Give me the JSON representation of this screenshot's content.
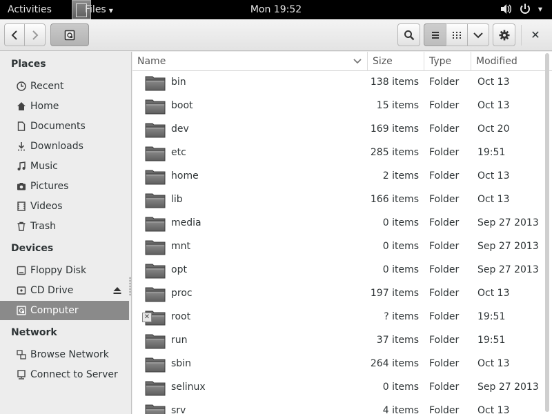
{
  "topbar": {
    "activities": "Activities",
    "app_name": "Files",
    "clock": "Mon 19:52"
  },
  "sidebar": {
    "headings": {
      "places": "Places",
      "devices": "Devices",
      "network": "Network"
    },
    "places": [
      {
        "label": "Recent",
        "icon": "clock-icon"
      },
      {
        "label": "Home",
        "icon": "home-icon"
      },
      {
        "label": "Documents",
        "icon": "document-icon"
      },
      {
        "label": "Downloads",
        "icon": "download-icon"
      },
      {
        "label": "Music",
        "icon": "music-icon"
      },
      {
        "label": "Pictures",
        "icon": "camera-icon"
      },
      {
        "label": "Videos",
        "icon": "film-icon"
      },
      {
        "label": "Trash",
        "icon": "trash-icon"
      }
    ],
    "devices": [
      {
        "label": "Floppy Disk",
        "icon": "floppy-icon"
      },
      {
        "label": "CD Drive",
        "icon": "cd-icon"
      },
      {
        "label": "Computer",
        "icon": "computer-icon",
        "selected": true
      }
    ],
    "network": [
      {
        "label": "Browse Network",
        "icon": "network-icon"
      },
      {
        "label": "Connect to Server",
        "icon": "server-icon"
      }
    ]
  },
  "columns": {
    "name": "Name",
    "size": "Size",
    "type": "Type",
    "modified": "Modified"
  },
  "files": [
    {
      "name": "bin",
      "size": "138 items",
      "type": "Folder",
      "modified": "Oct 13"
    },
    {
      "name": "boot",
      "size": "15 items",
      "type": "Folder",
      "modified": "Oct 13"
    },
    {
      "name": "dev",
      "size": "169 items",
      "type": "Folder",
      "modified": "Oct 20"
    },
    {
      "name": "etc",
      "size": "285 items",
      "type": "Folder",
      "modified": "19:51"
    },
    {
      "name": "home",
      "size": "2 items",
      "type": "Folder",
      "modified": "Oct 13"
    },
    {
      "name": "lib",
      "size": "166 items",
      "type": "Folder",
      "modified": "Oct 13"
    },
    {
      "name": "media",
      "size": "0 items",
      "type": "Folder",
      "modified": "Sep 27 2013"
    },
    {
      "name": "mnt",
      "size": "0 items",
      "type": "Folder",
      "modified": "Sep 27 2013"
    },
    {
      "name": "opt",
      "size": "0 items",
      "type": "Folder",
      "modified": "Sep 27 2013"
    },
    {
      "name": "proc",
      "size": "197 items",
      "type": "Folder",
      "modified": "Oct 13"
    },
    {
      "name": "root",
      "size": "? items",
      "type": "Folder",
      "modified": "19:51",
      "locked": true
    },
    {
      "name": "run",
      "size": "37 items",
      "type": "Folder",
      "modified": "19:51"
    },
    {
      "name": "sbin",
      "size": "264 items",
      "type": "Folder",
      "modified": "Oct 13"
    },
    {
      "name": "selinux",
      "size": "0 items",
      "type": "Folder",
      "modified": "Sep 27 2013"
    },
    {
      "name": "srv",
      "size": "4 items",
      "type": "Folder",
      "modified": "Oct 13"
    }
  ]
}
